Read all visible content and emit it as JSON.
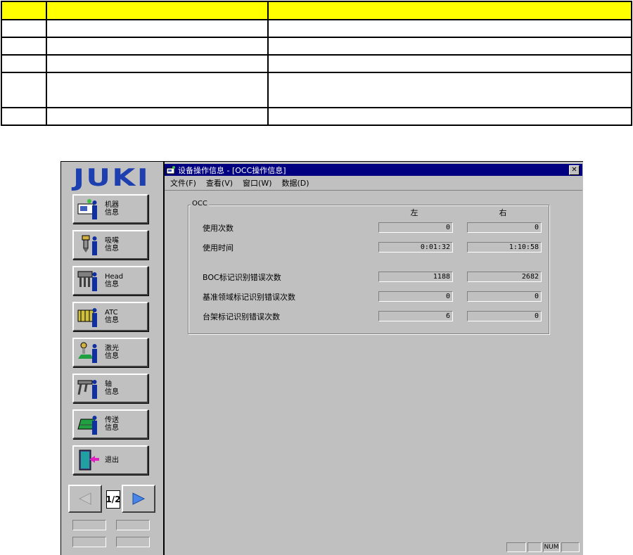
{
  "table": {
    "header": [
      "",
      "",
      ""
    ],
    "rows": [
      [
        "",
        "",
        ""
      ],
      [
        "",
        "",
        ""
      ],
      [
        "",
        "",
        ""
      ],
      [
        "",
        "",
        ""
      ],
      [
        "",
        "",
        ""
      ]
    ]
  },
  "sidebar": {
    "logo": "JUKI",
    "buttons": [
      {
        "label": "机器\n信息",
        "icon": "machine-info-icon"
      },
      {
        "label": "吸嘴\n信息",
        "icon": "nozzle-info-icon"
      },
      {
        "label": "Head\n信息",
        "icon": "head-info-icon"
      },
      {
        "label": "ATC\n信息",
        "icon": "atc-info-icon"
      },
      {
        "label": "激光\n信息",
        "icon": "laser-info-icon"
      },
      {
        "label": "轴\n信息",
        "icon": "axis-info-icon"
      },
      {
        "label": "传送\n信息",
        "icon": "conveyor-info-icon"
      },
      {
        "label": "退出",
        "icon": "exit-icon"
      }
    ],
    "page_indicator": "1/2"
  },
  "window": {
    "title": "设备操作信息 - [OCC操作信息]",
    "close_label": "✕",
    "menu": [
      "文件(F)",
      "查看(V)",
      "窗口(W)",
      "数据(D)"
    ]
  },
  "occ": {
    "group_label": "OCC",
    "col_left": "左",
    "col_right": "右",
    "rows": [
      {
        "label": "使用次数",
        "left": "0",
        "right": "0"
      },
      {
        "label": "使用时间",
        "left": "0:01:32",
        "right": "1:10:58"
      },
      {
        "label": "BOC标记识别错误次数",
        "left": "1188",
        "right": "2682"
      },
      {
        "label": "基准领域标记识别错误次数",
        "left": "0",
        "right": "0"
      },
      {
        "label": "台架标记识别错误次数",
        "left": "6",
        "right": "0"
      }
    ]
  },
  "statusbar": {
    "num": "NUM"
  },
  "colors": {
    "header_yellow": "#ffff00",
    "titlebar": "#000080",
    "logo_blue": "#1e3fb0",
    "face": "#c0c0c0"
  }
}
